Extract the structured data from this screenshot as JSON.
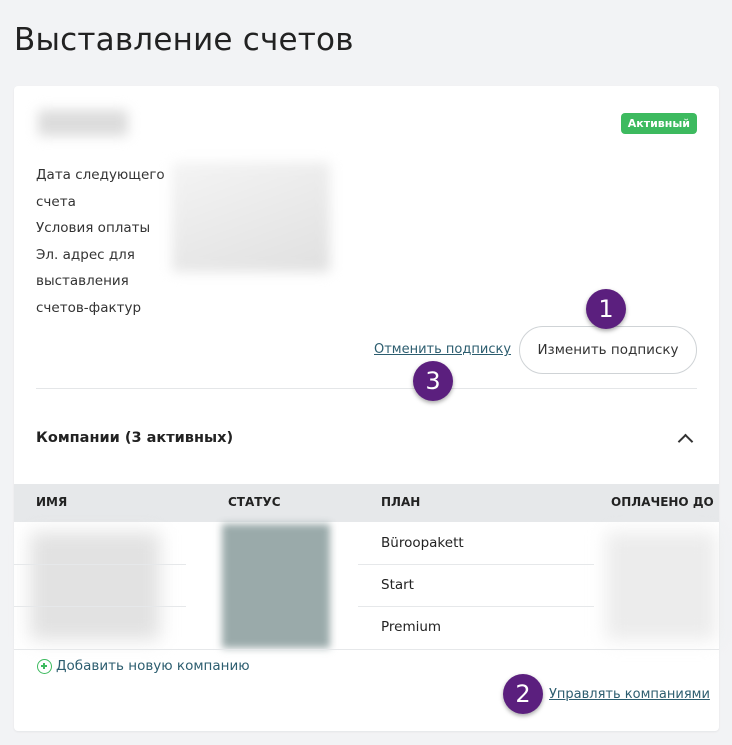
{
  "page": {
    "title": "Выставление счетов"
  },
  "subscription": {
    "status_badge": "Активный",
    "labels": {
      "next_invoice_1": "Дата следующего",
      "next_invoice_2": "счета",
      "payment_terms": "Условия оплаты",
      "invoice_email_1": "Эл. адрес для",
      "invoice_email_2": "выставления",
      "invoice_email_3": "счетов-фактур"
    },
    "cancel_label": "Отменить подписку",
    "change_label": "Изменить подписку"
  },
  "companies": {
    "title": "Компании (3 активных)",
    "columns": [
      "ИМЯ",
      "СТАТУС",
      "ПЛАН",
      "ОПЛАЧЕНО ДО"
    ],
    "rows": [
      {
        "plan": "Büroopakett"
      },
      {
        "plan": "Start"
      },
      {
        "plan": "Premium"
      }
    ],
    "add_label": "Добавить новую компанию",
    "manage_label": "Управлять компаниями"
  },
  "markers": [
    "1",
    "2",
    "3"
  ],
  "colors": {
    "accent_green": "#3dba5f",
    "link": "#2c5d6f",
    "marker": "#5b1f7e"
  }
}
